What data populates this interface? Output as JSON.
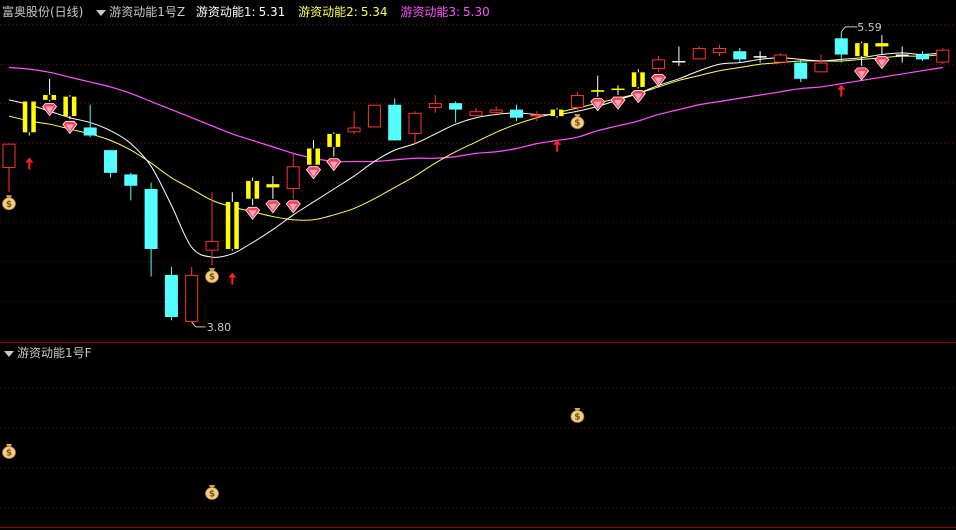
{
  "header": {
    "stock_name": "富奥股份(日线)",
    "indicator_main": "游资动能1号Z",
    "line1_label": "游资动能1:",
    "line1_value": "5.31",
    "line2_label": "游资动能2:",
    "line2_value": "5.34",
    "line3_label": "游资动能3:",
    "line3_value": "5.30",
    "indicator_sub": "游资动能1号F"
  },
  "colors": {
    "background": "#000000",
    "up_candle": "#ff3232",
    "down_candle": "#54ffff",
    "yellow_candle": "#ffff00",
    "line1": "#ffffff",
    "line2": "#ffff54",
    "line3": "#ff54ff",
    "grid": "#7a0000",
    "separator": "#8b0000",
    "text": "#c8c8c8"
  },
  "chart_data": {
    "type": "candlestick",
    "price_range": [
      3.75,
      5.7
    ],
    "high_label": "5.59",
    "low_label": "3.80",
    "candles": [
      {
        "o": 4.75,
        "c": 4.9,
        "h": 4.9,
        "l": 4.6,
        "color": "red"
      },
      {
        "o": 4.97,
        "c": 5.16,
        "h": 5.16,
        "l": 4.95,
        "color": "yellow"
      },
      {
        "o": 5.17,
        "c": 5.2,
        "h": 5.3,
        "l": 5.16,
        "color": "yellow"
      },
      {
        "o": 5.19,
        "c": 5.07,
        "h": 5.2,
        "l": 5.05,
        "color": "yellow"
      },
      {
        "o": 5.0,
        "c": 4.95,
        "h": 5.14,
        "l": 4.94,
        "color": "cyan"
      },
      {
        "o": 4.86,
        "c": 4.72,
        "h": 4.86,
        "l": 4.69,
        "color": "cyan"
      },
      {
        "o": 4.71,
        "c": 4.64,
        "h": 4.72,
        "l": 4.55,
        "color": "cyan"
      },
      {
        "o": 4.62,
        "c": 4.25,
        "h": 4.66,
        "l": 4.08,
        "color": "cyan"
      },
      {
        "o": 4.09,
        "c": 3.83,
        "h": 4.14,
        "l": 3.81,
        "color": "cyan"
      },
      {
        "o": 3.8,
        "c": 4.09,
        "h": 4.14,
        "l": 3.8,
        "color": "red"
      },
      {
        "o": 4.3,
        "c": 4.24,
        "h": 4.6,
        "l": 4.15,
        "color": "red"
      },
      {
        "o": 4.25,
        "c": 4.54,
        "h": 4.6,
        "l": 4.24,
        "color": "yellow"
      },
      {
        "o": 4.56,
        "c": 4.67,
        "h": 4.69,
        "l": 4.52,
        "color": "yellow"
      },
      {
        "o": 4.63,
        "c": 4.65,
        "h": 4.7,
        "l": 4.56,
        "color": "yellow"
      },
      {
        "o": 4.62,
        "c": 4.76,
        "h": 4.84,
        "l": 4.56,
        "color": "red"
      },
      {
        "o": 4.77,
        "c": 4.87,
        "h": 4.92,
        "l": 4.77,
        "color": "yellow"
      },
      {
        "o": 4.88,
        "c": 4.96,
        "h": 4.97,
        "l": 4.82,
        "color": "yellow"
      },
      {
        "o": 4.97,
        "c": 5.0,
        "h": 5.1,
        "l": 4.96,
        "color": "red"
      },
      {
        "o": 5.0,
        "c": 5.14,
        "h": 5.14,
        "l": 5.0,
        "color": "red"
      },
      {
        "o": 5.14,
        "c": 4.92,
        "h": 5.18,
        "l": 4.92,
        "color": "cyan"
      },
      {
        "o": 4.96,
        "c": 5.09,
        "h": 5.1,
        "l": 4.9,
        "color": "red"
      },
      {
        "o": 5.12,
        "c": 5.15,
        "h": 5.2,
        "l": 5.09,
        "color": "red"
      },
      {
        "o": 5.15,
        "c": 5.11,
        "h": 5.16,
        "l": 5.03,
        "color": "cyan"
      },
      {
        "o": 5.1,
        "c": 5.07,
        "h": 5.12,
        "l": 5.07,
        "color": "red"
      },
      {
        "o": 5.09,
        "c": 5.11,
        "h": 5.13,
        "l": 5.08,
        "color": "red"
      },
      {
        "o": 5.11,
        "c": 5.06,
        "h": 5.14,
        "l": 5.04,
        "color": "cyan"
      },
      {
        "o": 5.07,
        "c": 5.08,
        "h": 5.1,
        "l": 5.04,
        "color": "red"
      },
      {
        "o": 5.07,
        "c": 5.11,
        "h": 5.12,
        "l": 5.06,
        "color": "yellow"
      },
      {
        "o": 5.12,
        "c": 5.2,
        "h": 5.22,
        "l": 5.1,
        "color": "red"
      },
      {
        "o": 5.22,
        "c": 5.23,
        "h": 5.32,
        "l": 5.19,
        "color": "yellow"
      },
      {
        "o": 5.24,
        "c": 5.24,
        "h": 5.26,
        "l": 5.2,
        "color": "yellow"
      },
      {
        "o": 5.25,
        "c": 5.34,
        "h": 5.36,
        "l": 5.24,
        "color": "yellow"
      },
      {
        "o": 5.36,
        "c": 5.42,
        "h": 5.44,
        "l": 5.34,
        "color": "red"
      },
      {
        "o": 5.41,
        "c": 5.41,
        "h": 5.5,
        "l": 5.38,
        "color": "white"
      },
      {
        "o": 5.42,
        "c": 5.49,
        "h": 5.5,
        "l": 5.42,
        "color": "red"
      },
      {
        "o": 5.46,
        "c": 5.49,
        "h": 5.51,
        "l": 5.44,
        "color": "red"
      },
      {
        "o": 5.47,
        "c": 5.42,
        "h": 5.49,
        "l": 5.4,
        "color": "cyan"
      },
      {
        "o": 5.44,
        "c": 5.44,
        "h": 5.47,
        "l": 5.4,
        "color": "white"
      },
      {
        "o": 5.4,
        "c": 5.45,
        "h": 5.46,
        "l": 5.4,
        "color": "red"
      },
      {
        "o": 5.4,
        "c": 5.3,
        "h": 5.42,
        "l": 5.28,
        "color": "cyan"
      },
      {
        "o": 5.34,
        "c": 5.4,
        "h": 5.45,
        "l": 5.34,
        "color": "red"
      },
      {
        "o": 5.55,
        "c": 5.45,
        "h": 5.59,
        "l": 5.4,
        "color": "cyan"
      },
      {
        "o": 5.44,
        "c": 5.52,
        "h": 5.53,
        "l": 5.38,
        "color": "yellow"
      },
      {
        "o": 5.5,
        "c": 5.52,
        "h": 5.57,
        "l": 5.45,
        "color": "yellow"
      },
      {
        "o": 5.45,
        "c": 5.45,
        "h": 5.5,
        "l": 5.4,
        "color": "white"
      },
      {
        "o": 5.45,
        "c": 5.42,
        "h": 5.47,
        "l": 5.41,
        "color": "cyan"
      },
      {
        "o": 5.4,
        "c": 5.48,
        "h": 5.49,
        "l": 5.39,
        "color": "red"
      }
    ],
    "line1": [
      5.17,
      5.14,
      5.1,
      5.06,
      5.03,
      4.98,
      4.9,
      4.76,
      4.52,
      4.26,
      4.2,
      4.22,
      4.29,
      4.37,
      4.46,
      4.54,
      4.62,
      4.7,
      4.79,
      4.86,
      4.9,
      4.96,
      5.02,
      5.06,
      5.08,
      5.09,
      5.08,
      5.08,
      5.1,
      5.13,
      5.17,
      5.21,
      5.26,
      5.3,
      5.35,
      5.39,
      5.4,
      5.42,
      5.43,
      5.42,
      5.41,
      5.42,
      5.43,
      5.45,
      5.46,
      5.45,
      5.46
    ],
    "line2": [
      5.07,
      5.04,
      5.02,
      4.99,
      4.96,
      4.92,
      4.86,
      4.78,
      4.69,
      4.62,
      4.55,
      4.51,
      4.48,
      4.45,
      4.43,
      4.43,
      4.46,
      4.5,
      4.56,
      4.63,
      4.7,
      4.78,
      4.85,
      4.91,
      4.97,
      5.02,
      5.06,
      5.09,
      5.12,
      5.15,
      5.18,
      5.21,
      5.25,
      5.29,
      5.32,
      5.35,
      5.37,
      5.39,
      5.4,
      5.41,
      5.41,
      5.41,
      5.42,
      5.43,
      5.44,
      5.44,
      5.45
    ],
    "line3": [
      5.37,
      5.36,
      5.34,
      5.31,
      5.28,
      5.25,
      5.21,
      5.16,
      5.11,
      5.06,
      5.01,
      4.96,
      4.92,
      4.88,
      4.84,
      4.81,
      4.79,
      4.79,
      4.79,
      4.8,
      4.81,
      4.81,
      4.82,
      4.84,
      4.85,
      4.87,
      4.9,
      4.92,
      4.94,
      4.98,
      5.01,
      5.04,
      5.08,
      5.11,
      5.14,
      5.16,
      5.18,
      5.2,
      5.22,
      5.24,
      5.25,
      5.27,
      5.29,
      5.31,
      5.33,
      5.35,
      5.37
    ],
    "diamond_candles": [
      2,
      3,
      12,
      13,
      14,
      15,
      16,
      29,
      30,
      31,
      32,
      42,
      43
    ],
    "arrow_candles": [
      1,
      11,
      27,
      41
    ],
    "moneybag_candles": [
      0,
      10,
      28
    ],
    "sub_moneybags": [
      {
        "candle": 0,
        "level": "mid"
      },
      {
        "candle": 10,
        "level": "low"
      },
      {
        "candle": 28,
        "level": "high"
      }
    ]
  }
}
